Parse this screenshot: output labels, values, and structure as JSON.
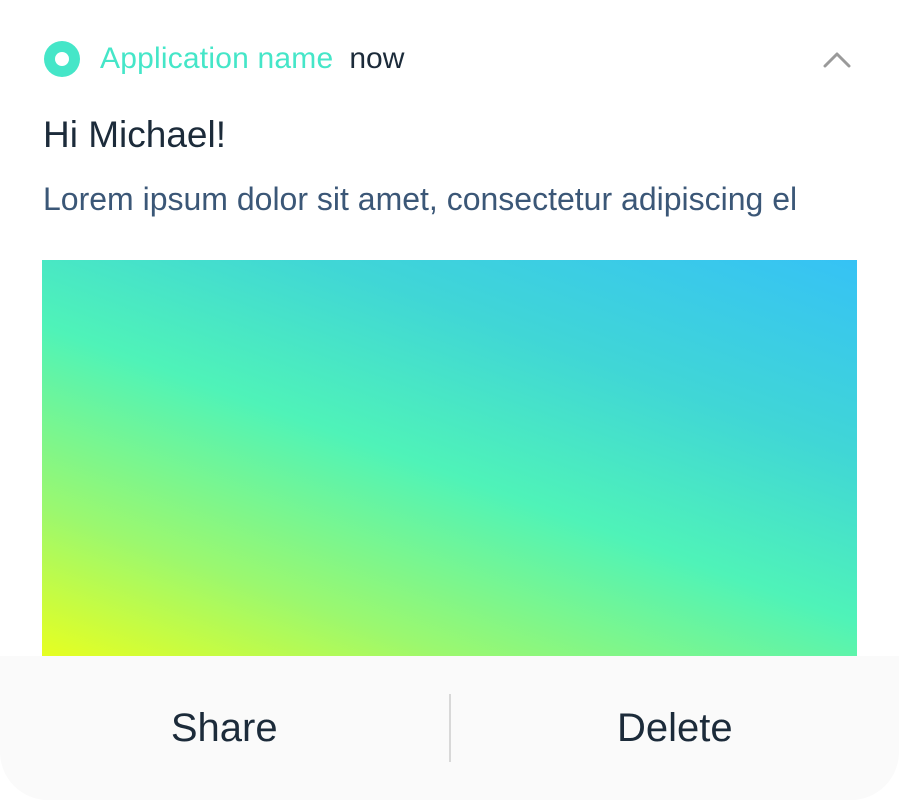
{
  "notification": {
    "app_name": "Application name",
    "timestamp": "now",
    "title": "Hi Michael!",
    "body": "Lorem ipsum dolor sit amet, consectetur adipiscing el",
    "icons": {
      "app": "app-icon",
      "collapse": "chevron-up-icon"
    },
    "colors": {
      "accent": "#45e6c8",
      "title": "#1c2b3a",
      "body": "#3b5777"
    }
  },
  "actions": {
    "share_label": "Share",
    "delete_label": "Delete"
  }
}
